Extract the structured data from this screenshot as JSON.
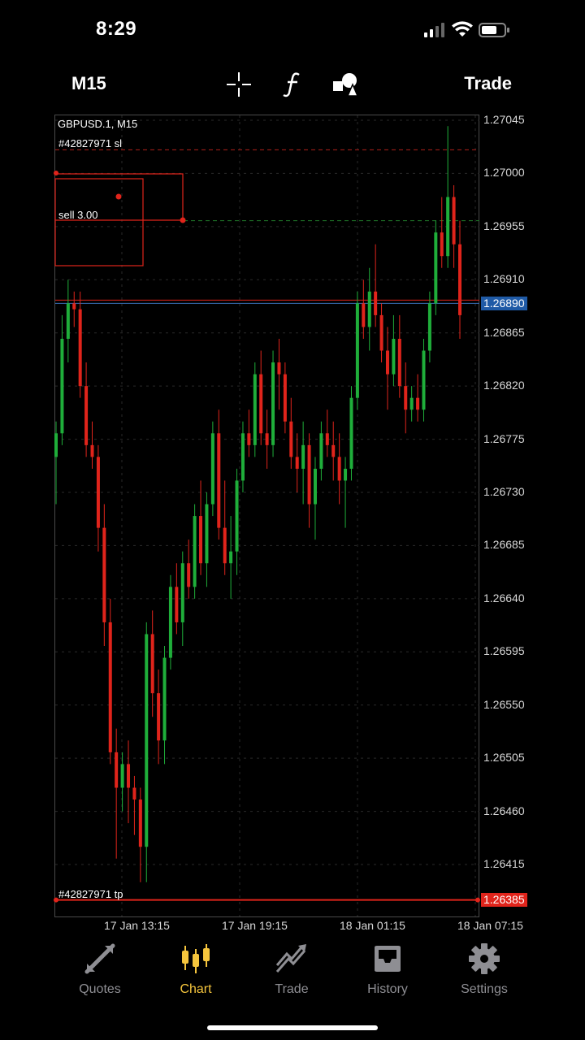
{
  "status_bar": {
    "time": "8:29"
  },
  "toolbar": {
    "timeframe": "M15",
    "crosshair_icon": "crosshair-icon",
    "indicators_icon": "function-icon",
    "objects_icon": "shapes-icon",
    "trade_label": "Trade"
  },
  "chart": {
    "symbol_label": "GBPUSD.1, M15",
    "sl_label": "#42827971 sl",
    "tp_label": "#42827971 tp",
    "order_label": "sell 3.00",
    "current_price": "1.26890",
    "tp_price": "1.26385",
    "colors": {
      "bull": "#1fae3a",
      "bear": "#e0241b",
      "current": "#1f5aa6",
      "grid": "#2a2a2a"
    }
  },
  "chart_data": {
    "type": "candlestick",
    "symbol": "GBPUSD.1",
    "timeframe": "M15",
    "y_ticks": [
      "1.27045",
      "1.27000",
      "1.26955",
      "1.26910",
      "1.26865",
      "1.26820",
      "1.26775",
      "1.26730",
      "1.26685",
      "1.26640",
      "1.26595",
      "1.26550",
      "1.26505",
      "1.26460",
      "1.26415"
    ],
    "x_ticks": [
      "17 Jan 13:15",
      "17 Jan 19:15",
      "18 Jan 01:15",
      "18 Jan 07:15"
    ],
    "ylim": [
      1.2638,
      1.2705
    ],
    "lines": {
      "sl": 1.2702,
      "tp": 1.26385,
      "bid": 1.2689,
      "order": 1.2696
    },
    "ohlc": [
      [
        1.2676,
        1.2679,
        1.2672,
        1.2678
      ],
      [
        1.2678,
        1.2688,
        1.2677,
        1.2686
      ],
      [
        1.2686,
        1.2691,
        1.2684,
        1.2689
      ],
      [
        1.2689,
        1.269,
        1.2687,
        1.26885
      ],
      [
        1.26885,
        1.269,
        1.2681,
        1.2682
      ],
      [
        1.2682,
        1.2684,
        1.2676,
        1.2677
      ],
      [
        1.2677,
        1.2679,
        1.2675,
        1.2676
      ],
      [
        1.2676,
        1.2677,
        1.2668,
        1.267
      ],
      [
        1.267,
        1.2672,
        1.266,
        1.2662
      ],
      [
        1.2662,
        1.2664,
        1.265,
        1.2651
      ],
      [
        1.2651,
        1.2653,
        1.2642,
        1.2648
      ],
      [
        1.2648,
        1.2651,
        1.2646,
        1.265
      ],
      [
        1.265,
        1.2652,
        1.2645,
        1.2648
      ],
      [
        1.2648,
        1.2649,
        1.2644,
        1.2647
      ],
      [
        1.2647,
        1.2648,
        1.264,
        1.2643
      ],
      [
        1.2643,
        1.2662,
        1.264,
        1.2661
      ],
      [
        1.2661,
        1.2663,
        1.2654,
        1.2656
      ],
      [
        1.2656,
        1.2658,
        1.265,
        1.2652
      ],
      [
        1.2652,
        1.266,
        1.265,
        1.2659
      ],
      [
        1.2659,
        1.2666,
        1.2658,
        1.2665
      ],
      [
        1.2665,
        1.2667,
        1.2661,
        1.2662
      ],
      [
        1.2662,
        1.2668,
        1.266,
        1.2667
      ],
      [
        1.2667,
        1.2669,
        1.2664,
        1.2665
      ],
      [
        1.2665,
        1.2672,
        1.2664,
        1.2671
      ],
      [
        1.2671,
        1.2674,
        1.2666,
        1.2667
      ],
      [
        1.2667,
        1.2673,
        1.2665,
        1.2672
      ],
      [
        1.2672,
        1.2679,
        1.2671,
        1.2678
      ],
      [
        1.2678,
        1.268,
        1.2669,
        1.267
      ],
      [
        1.267,
        1.2674,
        1.2666,
        1.2667
      ],
      [
        1.2667,
        1.2671,
        1.2664,
        1.2668
      ],
      [
        1.2668,
        1.2675,
        1.2666,
        1.2674
      ],
      [
        1.2674,
        1.2679,
        1.2673,
        1.2678
      ],
      [
        1.2678,
        1.268,
        1.2676,
        1.2677
      ],
      [
        1.2677,
        1.2684,
        1.2676,
        1.2683
      ],
      [
        1.2683,
        1.2685,
        1.2677,
        1.2678
      ],
      [
        1.2678,
        1.268,
        1.2675,
        1.2677
      ],
      [
        1.2677,
        1.2685,
        1.2676,
        1.2684
      ],
      [
        1.2684,
        1.2686,
        1.268,
        1.2683
      ],
      [
        1.2683,
        1.2684,
        1.2678,
        1.2679
      ],
      [
        1.2679,
        1.2681,
        1.2675,
        1.2676
      ],
      [
        1.2676,
        1.2678,
        1.2673,
        1.2675
      ],
      [
        1.2675,
        1.2679,
        1.2672,
        1.2677
      ],
      [
        1.2677,
        1.2678,
        1.267,
        1.2672
      ],
      [
        1.2672,
        1.2676,
        1.2669,
        1.2675
      ],
      [
        1.2675,
        1.2679,
        1.2674,
        1.2678
      ],
      [
        1.2678,
        1.268,
        1.2676,
        1.2677
      ],
      [
        1.2677,
        1.2679,
        1.2674,
        1.2676
      ],
      [
        1.2676,
        1.2678,
        1.2672,
        1.2674
      ],
      [
        1.2674,
        1.2676,
        1.267,
        1.2675
      ],
      [
        1.2675,
        1.2682,
        1.2674,
        1.2681
      ],
      [
        1.2681,
        1.269,
        1.268,
        1.2689
      ],
      [
        1.2689,
        1.2691,
        1.2686,
        1.2687
      ],
      [
        1.2687,
        1.2692,
        1.2685,
        1.269
      ],
      [
        1.269,
        1.2694,
        1.2687,
        1.2688
      ],
      [
        1.2688,
        1.2689,
        1.2684,
        1.2685
      ],
      [
        1.2685,
        1.2687,
        1.268,
        1.2683
      ],
      [
        1.2683,
        1.2688,
        1.2682,
        1.2686
      ],
      [
        1.2686,
        1.2688,
        1.2681,
        1.2682
      ],
      [
        1.2682,
        1.2684,
        1.2678,
        1.268
      ],
      [
        1.268,
        1.2682,
        1.2679,
        1.2681
      ],
      [
        1.2681,
        1.2683,
        1.2679,
        1.268
      ],
      [
        1.268,
        1.2686,
        1.2679,
        1.2685
      ],
      [
        1.2685,
        1.269,
        1.2684,
        1.2689
      ],
      [
        1.2689,
        1.2696,
        1.2688,
        1.2695
      ],
      [
        1.2695,
        1.2698,
        1.2692,
        1.2693
      ],
      [
        1.2693,
        1.2704,
        1.2692,
        1.2698
      ],
      [
        1.2698,
        1.2699,
        1.2692,
        1.2694
      ],
      [
        1.2694,
        1.2696,
        1.2686,
        1.2688
      ]
    ]
  },
  "bottom_nav": {
    "items": [
      {
        "label": "Quotes",
        "icon": "quotes-icon",
        "active": false
      },
      {
        "label": "Chart",
        "icon": "candles-icon",
        "active": true
      },
      {
        "label": "Trade",
        "icon": "trade-icon",
        "active": false
      },
      {
        "label": "History",
        "icon": "inbox-icon",
        "active": false
      },
      {
        "label": "Settings",
        "icon": "gear-icon",
        "active": false
      }
    ]
  }
}
